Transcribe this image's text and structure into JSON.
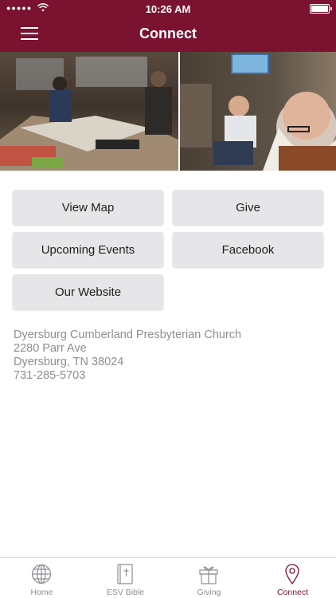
{
  "status_bar": {
    "time": "10:26 AM",
    "signal": "●●●●●"
  },
  "header": {
    "title": "Connect",
    "menu_icon": "hamburger-menu-icon"
  },
  "colors": {
    "brand": "#7a1230",
    "button_bg": "#e6e6e8",
    "muted_text": "#8e8e93"
  },
  "buttons": [
    {
      "label": "View Map"
    },
    {
      "label": "Give"
    },
    {
      "label": "Upcoming Events"
    },
    {
      "label": "Facebook"
    },
    {
      "label": "Our Website"
    }
  ],
  "address": {
    "church": "Dyersburg Cumberland Presbyterian Church",
    "street": "2280 Parr Ave",
    "city": "Dyersburg, TN 38024",
    "phone": "731-285-5703"
  },
  "tabs": [
    {
      "label": "Home",
      "icon": "globe-icon",
      "active": false
    },
    {
      "label": "ESV Bible",
      "icon": "bible-icon",
      "active": false
    },
    {
      "label": "Giving",
      "icon": "gift-icon",
      "active": false
    },
    {
      "label": "Connect",
      "icon": "map-pin-icon",
      "active": true
    }
  ]
}
